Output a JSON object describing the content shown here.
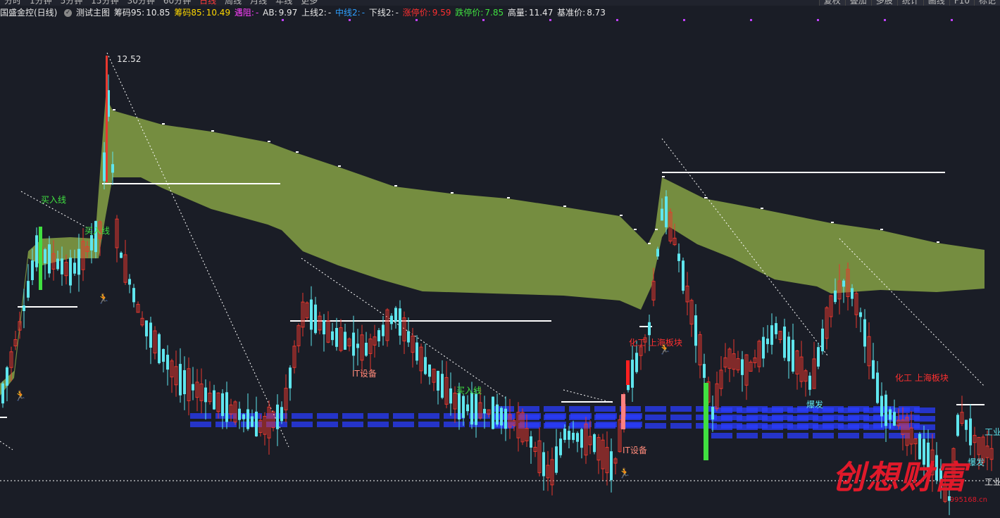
{
  "topbar": {
    "periods": [
      "分时",
      "1分钟",
      "5分钟",
      "15分钟",
      "30分钟",
      "60分钟",
      "日线",
      "周线",
      "月线",
      "年线",
      "更多"
    ],
    "active_period": "日线",
    "tools": [
      "复权",
      "叠加",
      "多股",
      "统计",
      "画线",
      "F10",
      "标记"
    ]
  },
  "info": {
    "stock_name": "国盛金控(日线)",
    "formula_icon": "circle-check-icon",
    "formula_name": "测试主图",
    "chip95_label": "筹码95:",
    "chip95_value": "10.85",
    "chip85_label": "筹码85:",
    "chip85_value": "10.49",
    "resist_label": "遇阻:",
    "resist_value": "-",
    "ab_label": "AB:",
    "ab_value": "9.97",
    "upper2_label": "上线2:",
    "upper2_value": "-",
    "mid2_label": "中线2:",
    "mid2_value": "-",
    "lower2_label": "下线2:",
    "lower2_value": "-",
    "limit_up_label": "涨停价:",
    "limit_up_value": "9.59",
    "limit_down_label": "跌停价:",
    "limit_down_value": "7.85",
    "high_label": "高量:",
    "high_value": "11.47",
    "base_label": "基准价:",
    "base_value": "8.73"
  },
  "chart": {
    "peak_label": "12.52",
    "signals": {
      "buy_line": "买入线",
      "it_equipment": "IT设备",
      "chemical_shanghai": "化工 上海板块",
      "burst": "爆发",
      "industry_cut": "工业"
    },
    "colors": {
      "background": "#1a1d26",
      "band": "#7a9441",
      "up": "#e8382e",
      "down": "#5fe6ee",
      "white_line": "#ffffff",
      "text_blue": "#2a3cff",
      "signal_green": "#40e040",
      "signal_red": "#ff3030",
      "signal_orange": "#ffa020"
    }
  },
  "watermark": {
    "main": "创想财富",
    "url": "995168.cn"
  }
}
